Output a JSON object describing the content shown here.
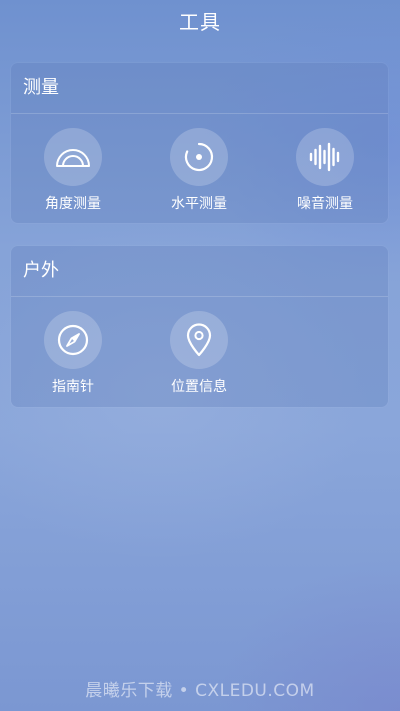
{
  "header": {
    "title": "工具"
  },
  "sections": [
    {
      "title": "测量",
      "items": [
        {
          "label": "角度测量",
          "icon": "protractor-icon"
        },
        {
          "label": "水平测量",
          "icon": "level-icon"
        },
        {
          "label": "噪音测量",
          "icon": "sound-wave-icon"
        }
      ]
    },
    {
      "title": "户外",
      "items": [
        {
          "label": "指南针",
          "icon": "compass-icon"
        },
        {
          "label": "位置信息",
          "icon": "location-pin-icon"
        }
      ]
    }
  ],
  "watermark": "晨曦乐下载 • CXLEDU.COM"
}
